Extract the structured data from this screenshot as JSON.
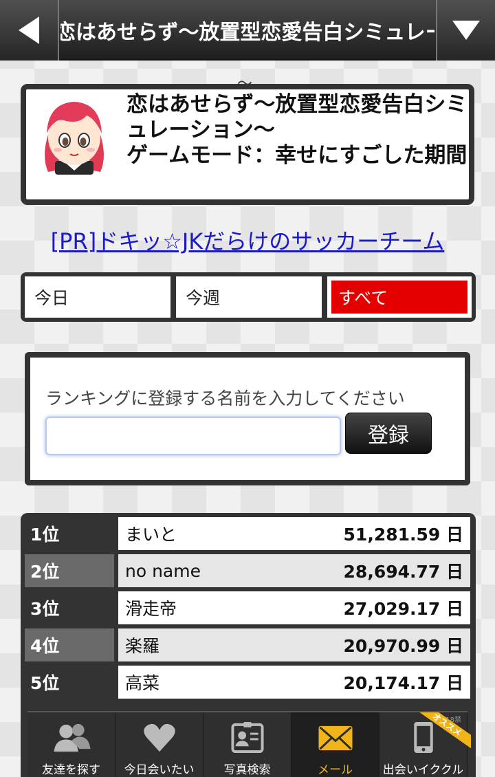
{
  "header": {
    "title": "恋はあせらず～放置型恋愛告白シミュレーション～"
  },
  "game": {
    "title_line": "恋はあせらず～放置型恋愛告白シミュレーション～",
    "mode_line": "ゲームモード：幸せにすごした期間"
  },
  "pr_link": "[PR]ドキッ☆JKだらけのサッカーチーム",
  "tabs": [
    {
      "label": "今日"
    },
    {
      "label": "今週"
    },
    {
      "label": "すべて"
    }
  ],
  "register": {
    "prompt": "ランキングに登録する名前を入力してください",
    "input_value": "",
    "button_label": "登録"
  },
  "ranking": [
    {
      "rank": "1位",
      "name": "まいと",
      "score": "51,281.59 日"
    },
    {
      "rank": "2位",
      "name": "no name",
      "score": "28,694.77 日"
    },
    {
      "rank": "3位",
      "name": "滑走帝",
      "score": "27,029.17 日"
    },
    {
      "rank": "4位",
      "name": "楽羅",
      "score": "20,970.99 日"
    },
    {
      "rank": "5位",
      "name": "高菜",
      "score": "20,174.17 日"
    }
  ],
  "bottom_nav": [
    {
      "label": "友達を探す",
      "icon": "people-icon"
    },
    {
      "label": "今日会いたい",
      "icon": "heart-icon"
    },
    {
      "label": "写真検索",
      "icon": "id-card-icon"
    },
    {
      "label": "メール",
      "icon": "mail-icon"
    },
    {
      "label": "出会いイククル",
      "icon": "phone-icon",
      "badge": "オススメ",
      "age_note": "18禁"
    }
  ],
  "colors": {
    "accent_red": "#e50000",
    "nav_active": "#f0b418",
    "link": "#1a1acc"
  }
}
